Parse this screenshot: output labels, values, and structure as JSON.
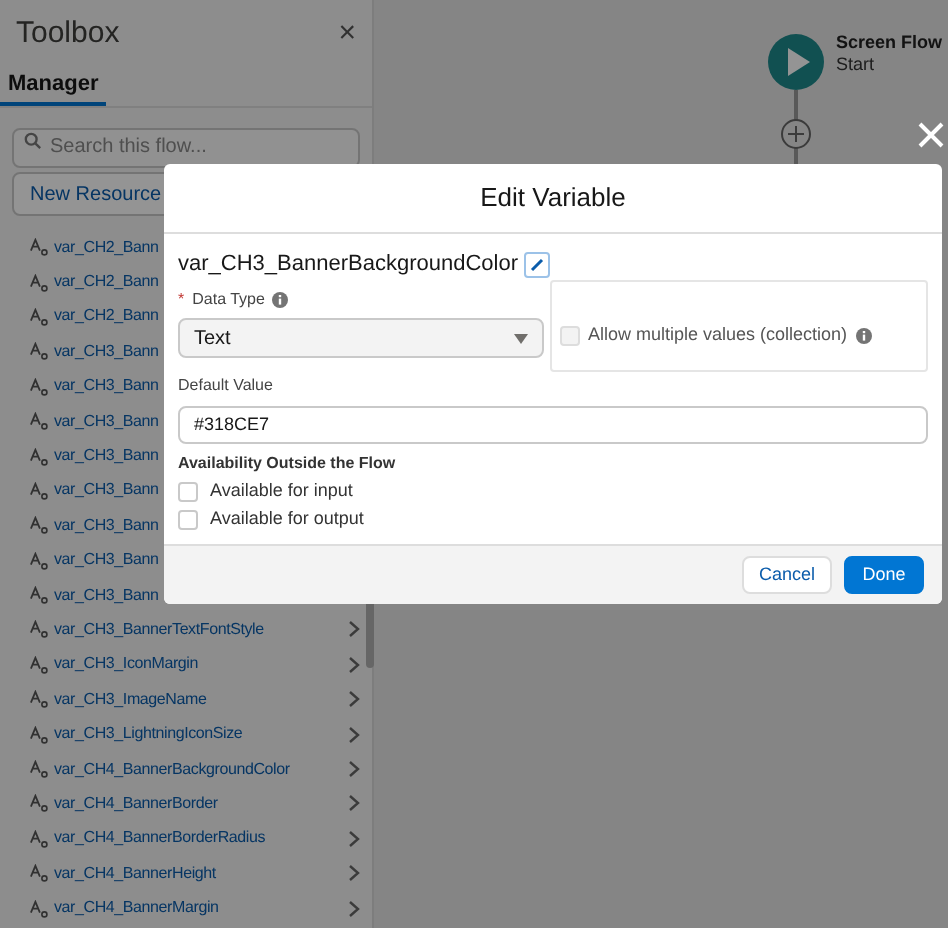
{
  "toolbox": {
    "title": "Toolbox",
    "close": "×",
    "tabs": [
      {
        "label": "Manager",
        "selected": true
      }
    ],
    "search": {
      "placeholder": "Search this flow..."
    },
    "new_button": "New Resource",
    "items": [
      {
        "label": "var_CH2_Bann",
        "kind": "cut"
      },
      {
        "label": "var_CH2_Bann",
        "kind": "cut"
      },
      {
        "label": "var_CH2_Bann",
        "kind": "cut"
      },
      {
        "label": "var_CH3_Bann",
        "kind": "cut"
      },
      {
        "label": "var_CH3_Bann",
        "kind": "cut"
      },
      {
        "label": "var_CH3_Bann",
        "kind": "cut"
      },
      {
        "label": "var_CH3_Bann",
        "kind": "cut"
      },
      {
        "label": "var_CH3_Bann",
        "kind": "cut"
      },
      {
        "label": "var_CH3_Bann",
        "kind": "cut"
      },
      {
        "label": "var_CH3_Bann",
        "kind": "cut"
      },
      {
        "label": "var_CH3_Bann",
        "kind": "cut"
      },
      {
        "label": "var_CH3_BannerTextFontStyle",
        "kind": "full"
      },
      {
        "label": "var_CH3_IconMargin",
        "kind": "full"
      },
      {
        "label": "var_CH3_ImageName",
        "kind": "full"
      },
      {
        "label": "var_CH3_LightningIconSize",
        "kind": "full"
      },
      {
        "label": "var_CH4_BannerBackgroundColor",
        "kind": "full"
      },
      {
        "label": "var_CH4_BannerBorder",
        "kind": "full"
      },
      {
        "label": "var_CH4_BannerBorderRadius",
        "kind": "full"
      },
      {
        "label": "var_CH4_BannerHeight",
        "kind": "full"
      },
      {
        "label": "var_CH4_BannerMargin",
        "kind": "full"
      }
    ]
  },
  "canvas": {
    "start": {
      "title": "Screen Flow",
      "subtitle": "Start"
    }
  },
  "modal": {
    "title": "Edit Variable",
    "api_name": "var_CH3_BannerBackgroundColor",
    "data_type": {
      "label": "Data Type",
      "required_mark": "*",
      "value": "Text"
    },
    "collection": {
      "label": "Allow multiple values (collection)",
      "checked": false,
      "disabled": true
    },
    "default_value": {
      "label": "Default Value",
      "value": "#318CE7"
    },
    "availability": {
      "heading": "Availability Outside the Flow",
      "options": [
        {
          "label": "Available for input",
          "checked": false
        },
        {
          "label": "Available for output",
          "checked": false
        }
      ]
    },
    "buttons": [
      {
        "label": "Cancel",
        "kind": "neutral"
      },
      {
        "label": "Done",
        "kind": "brand"
      }
    ]
  }
}
